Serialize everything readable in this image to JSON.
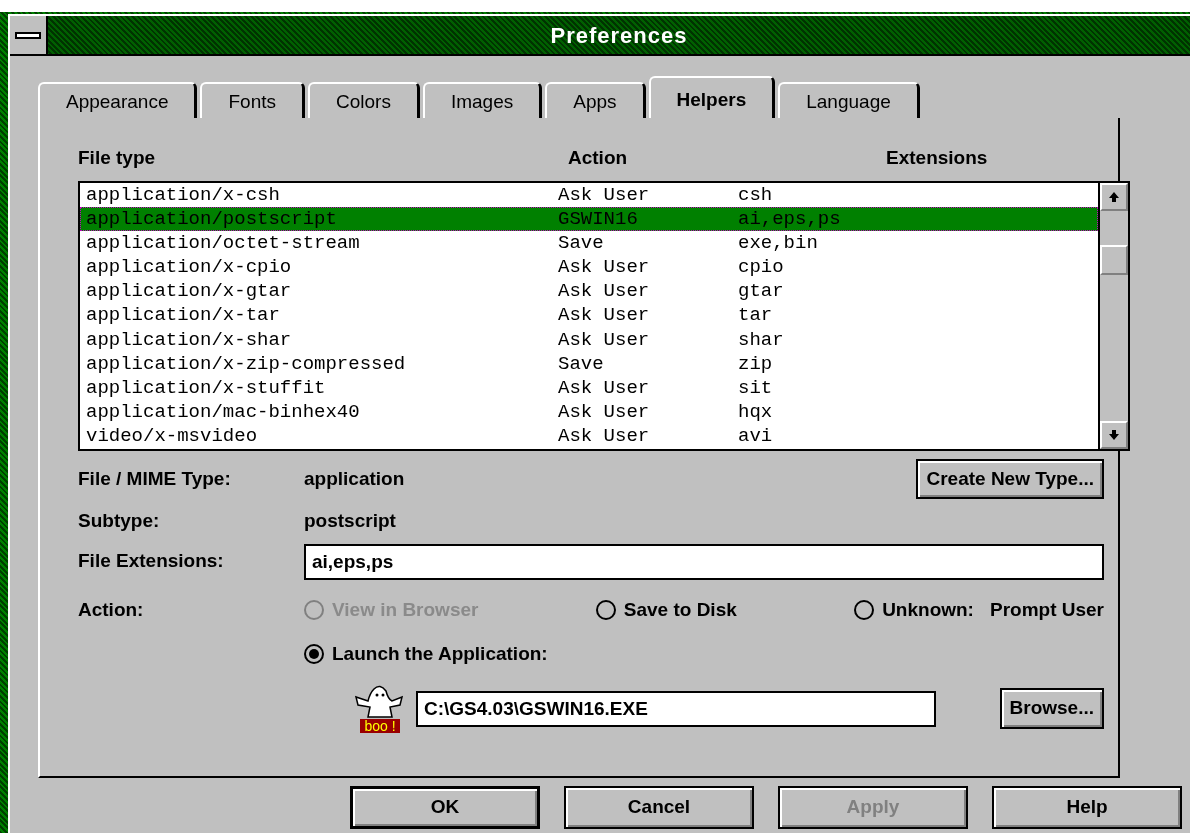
{
  "window": {
    "title": "Preferences"
  },
  "tabs": [
    {
      "label": "Appearance",
      "selected": false
    },
    {
      "label": "Fonts",
      "selected": false
    },
    {
      "label": "Colors",
      "selected": false
    },
    {
      "label": "Images",
      "selected": false
    },
    {
      "label": "Apps",
      "selected": false
    },
    {
      "label": "Helpers",
      "selected": true
    },
    {
      "label": "Language",
      "selected": false
    }
  ],
  "table": {
    "columns": [
      "File type",
      "Action",
      "Extensions"
    ],
    "rows": [
      {
        "cells": [
          "application/x-csh",
          "Ask User",
          "csh"
        ],
        "selected": false
      },
      {
        "cells": [
          "application/postscript",
          "GSWIN16",
          "ai,eps,ps"
        ],
        "selected": true
      },
      {
        "cells": [
          "application/octet-stream",
          "Save",
          "exe,bin"
        ],
        "selected": false
      },
      {
        "cells": [
          "application/x-cpio",
          "Ask User",
          "cpio"
        ],
        "selected": false
      },
      {
        "cells": [
          "application/x-gtar",
          "Ask User",
          "gtar"
        ],
        "selected": false
      },
      {
        "cells": [
          "application/x-tar",
          "Ask User",
          "tar"
        ],
        "selected": false
      },
      {
        "cells": [
          "application/x-shar",
          "Ask User",
          "shar"
        ],
        "selected": false
      },
      {
        "cells": [
          "application/x-zip-compressed",
          "Save",
          "zip"
        ],
        "selected": false
      },
      {
        "cells": [
          "application/x-stuffit",
          "Ask User",
          "sit"
        ],
        "selected": false
      },
      {
        "cells": [
          "application/mac-binhex40",
          "Ask User",
          "hqx"
        ],
        "selected": false
      },
      {
        "cells": [
          "video/x-msvideo",
          "Ask User",
          "avi"
        ],
        "selected": false
      }
    ]
  },
  "details": {
    "mime_label": "File / MIME Type:",
    "mime_value": "application",
    "create_button": "Create New Type...",
    "subtype_label": "Subtype:",
    "subtype_value": "postscript",
    "extensions_label": "File Extensions:",
    "extensions_value": "ai,eps,ps"
  },
  "action": {
    "label": "Action:",
    "options": [
      {
        "label": "View in Browser",
        "selected": false,
        "disabled": true
      },
      {
        "label": "Save to Disk",
        "selected": false,
        "disabled": false
      },
      {
        "label": "Unknown:",
        "extra": "Prompt User",
        "selected": false,
        "disabled": false
      },
      {
        "label": "Launch the Application:",
        "selected": true,
        "disabled": false
      }
    ],
    "app_icon_text": "boo !",
    "app_path": "C:\\GS4.03\\GSWIN16.EXE",
    "browse_button": "Browse..."
  },
  "buttons": [
    {
      "label": "OK",
      "default": true,
      "disabled": false
    },
    {
      "label": "Cancel",
      "default": false,
      "disabled": false
    },
    {
      "label": "Apply",
      "default": false,
      "disabled": true
    },
    {
      "label": "Help",
      "default": false,
      "disabled": false
    }
  ]
}
